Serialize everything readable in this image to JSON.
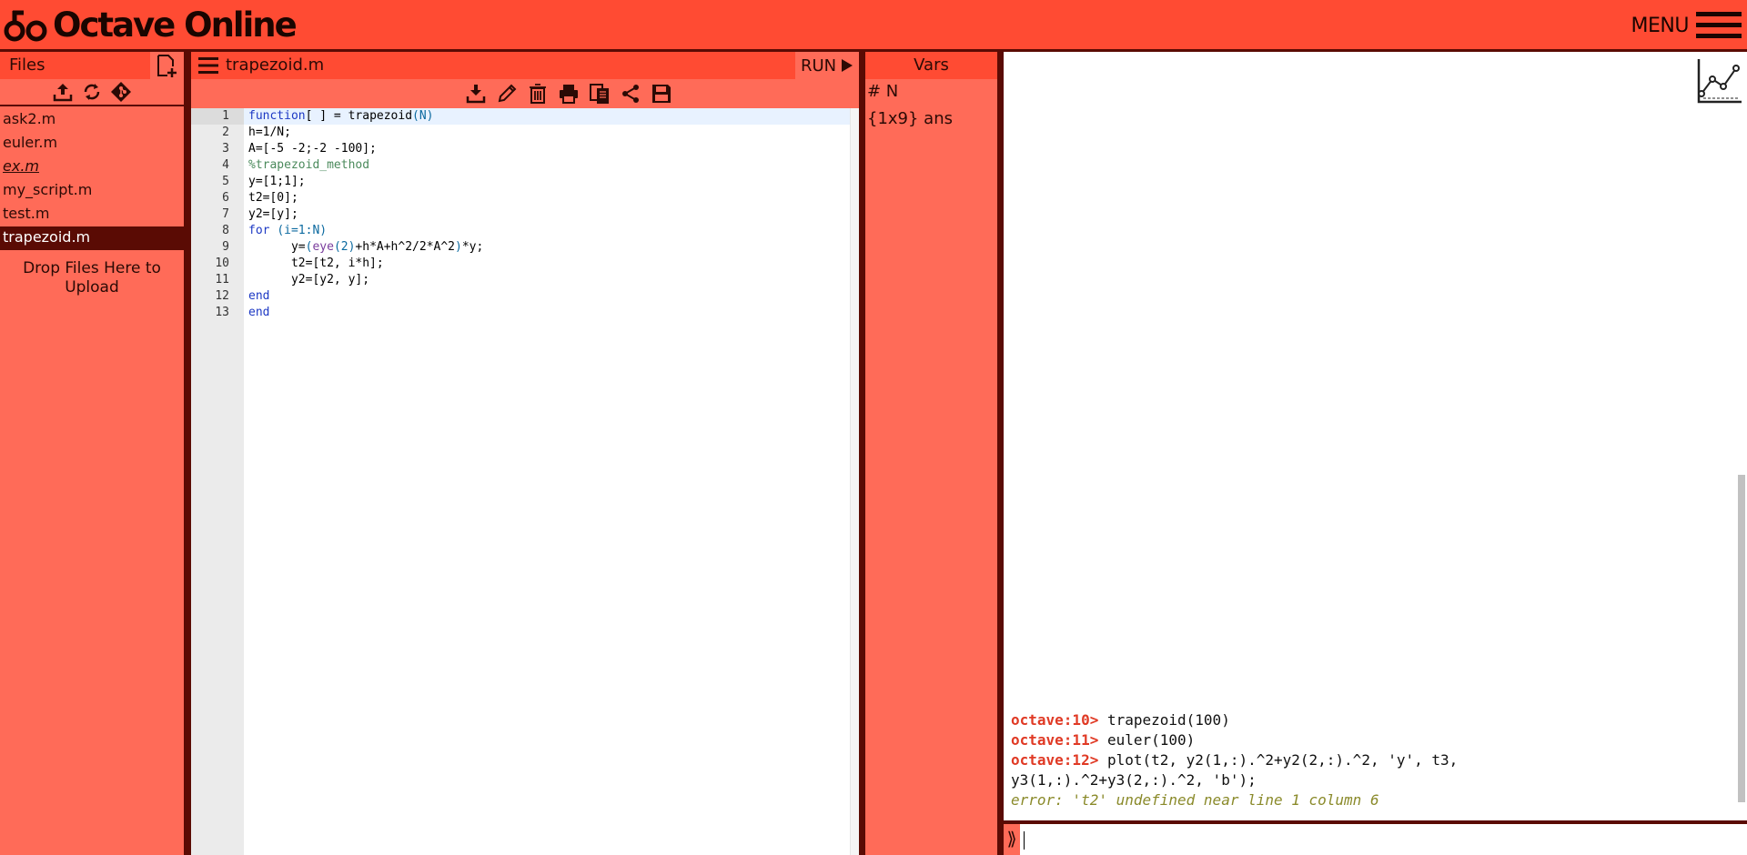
{
  "app": {
    "title": "Octave Online",
    "menu_label": "MENU",
    "colors": {
      "header": "#ff4b33",
      "panel": "#ff6b58",
      "frame": "#5a0b04",
      "prompt": "#e03a25"
    }
  },
  "files": {
    "title": "Files",
    "toolbar_icons": [
      "upload-icon",
      "refresh-icon",
      "git-icon"
    ],
    "items": [
      {
        "name": "ask2.m"
      },
      {
        "name": "euler.m"
      },
      {
        "name": "ex.m"
      },
      {
        "name": "my_script.m"
      },
      {
        "name": "test.m"
      },
      {
        "name": "trapezoid.m"
      }
    ],
    "active": "trapezoid.m",
    "drop_text": "Drop Files Here to Upload"
  },
  "editor": {
    "filename": "trapezoid.m",
    "run_label": "RUN",
    "toolbar_icons": [
      "download-icon",
      "rename-icon",
      "delete-icon",
      "print-icon",
      "copy-icon",
      "share-icon",
      "save-icon"
    ],
    "line_numbers": [
      "1",
      "2",
      "3",
      "4",
      "5",
      "6",
      "7",
      "8",
      "9",
      "10",
      "11",
      "12",
      "13"
    ],
    "active_line": 1
  },
  "vars": {
    "title": "Vars",
    "items": [
      {
        "label": "# N"
      },
      {
        "label": "{1x9} ans"
      }
    ]
  },
  "console": {
    "lines": [
      {
        "prompt": "octave:10>",
        "cmd": " trapezoid(100)"
      },
      {
        "prompt": "octave:11>",
        "cmd": " euler(100)"
      },
      {
        "prompt": "octave:12>",
        "cmd": " plot(t2, y2(1,:).^2+y2(2,:).^2, 'y', t3,"
      },
      {
        "prompt": "",
        "cmd": "y3(1,:).^2+y3(2,:).^2, 'b');"
      }
    ],
    "error": "error: 't2' undefined near line 1 column 6",
    "input_glyph": "⟫",
    "input_value": ""
  }
}
